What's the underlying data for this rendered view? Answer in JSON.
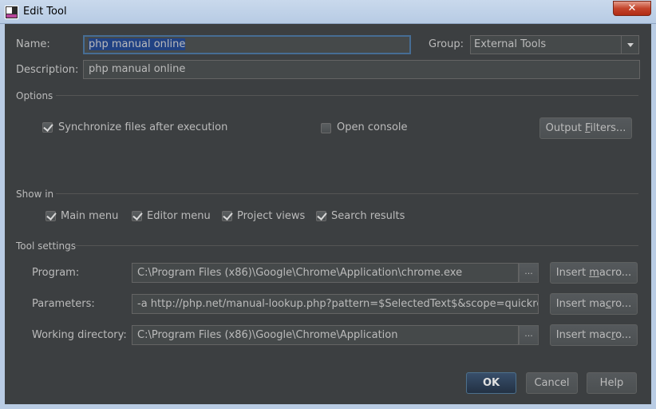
{
  "window": {
    "title": "Edit Tool",
    "close_glyph": "✕"
  },
  "form": {
    "name_label": "Name:",
    "name_value": "php manual online",
    "group_label": "Group:",
    "group_value": "External Tools",
    "description_label": "Description:",
    "description_value": "php manual online"
  },
  "options": {
    "section_label": "Options",
    "sync_files_label": "Synchronize files after execution",
    "sync_files_checked": true,
    "open_console_label": "Open console",
    "open_console_checked": false,
    "output_filters": {
      "pre": "Output ",
      "mnemonic": "F",
      "post": "ilters..."
    }
  },
  "show_in": {
    "section_label": "Show in",
    "items": [
      {
        "label": "Main menu",
        "checked": true
      },
      {
        "label": "Editor menu",
        "checked": true
      },
      {
        "label": "Project views",
        "checked": true
      },
      {
        "label": "Search results",
        "checked": true
      }
    ]
  },
  "tool_settings": {
    "section_label": "Tool settings",
    "program_label": "Program:",
    "program_value": "C:\\Program Files (x86)\\Google\\Chrome\\Application\\chrome.exe",
    "parameters_label": "Parameters:",
    "parameters_value": "-a  http://php.net/manual-lookup.php?pattern=$SelectedText$&scope=quickref",
    "working_dir_label": "Working directory:",
    "working_dir_value": "C:\\Program Files (x86)\\Google\\Chrome\\Application",
    "browse_glyph": "...",
    "insert_macro": {
      "pre": "Insert ",
      "mnemonic": "m",
      "post": "acro..."
    },
    "insert_macro_params": {
      "pre": "Insert ma",
      "mnemonic": "c",
      "post": "ro..."
    },
    "insert_macro_dir": {
      "pre": "Insert mac",
      "mnemonic": "r",
      "post": "o..."
    }
  },
  "footer": {
    "ok_label": "OK",
    "cancel_label": "Cancel",
    "help_label": "Help"
  }
}
